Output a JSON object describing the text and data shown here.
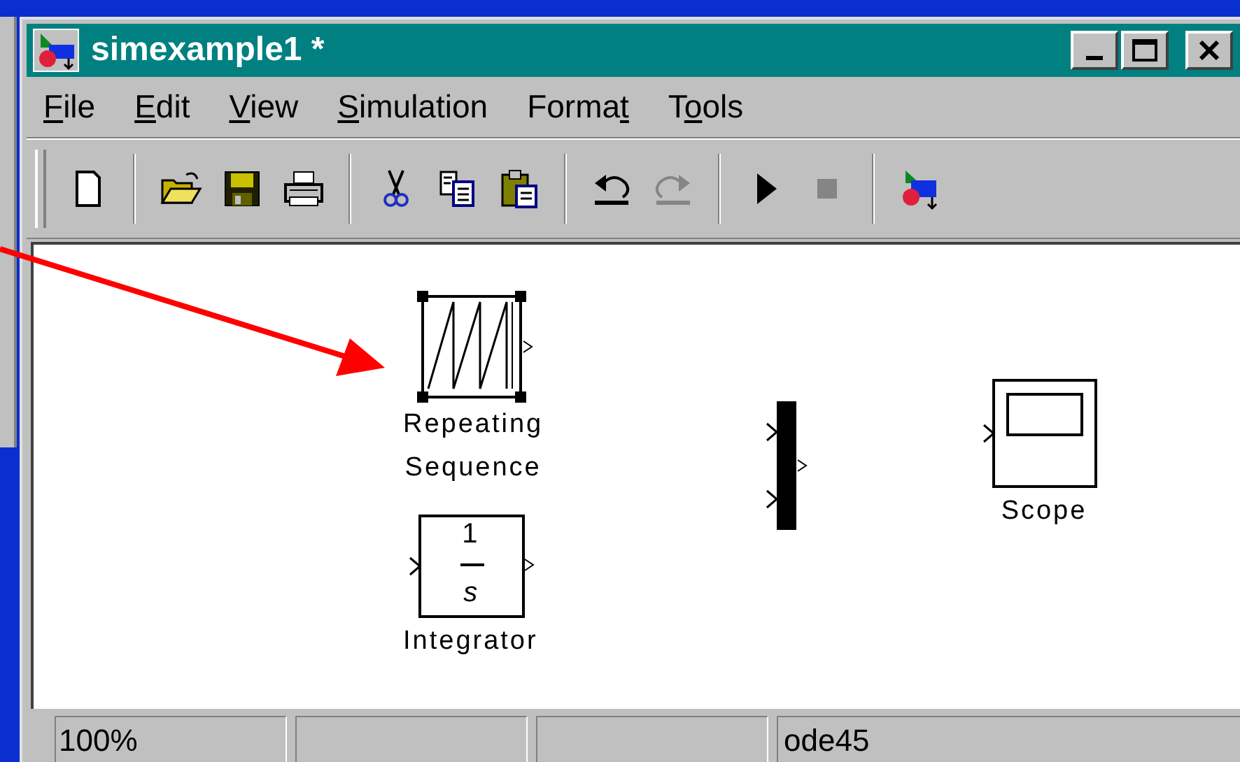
{
  "window": {
    "title": "simexample1 *"
  },
  "menu": [
    {
      "key": "F",
      "after": "ile"
    },
    {
      "key": "E",
      "after": "dit"
    },
    {
      "key": "V",
      "after": "iew"
    },
    {
      "key": "S",
      "after": "imulation"
    },
    {
      "before": "Forma",
      "key": "t"
    },
    {
      "before": "T",
      "key": "o",
      "after": "ols"
    }
  ],
  "toolbar_groups": [
    [
      {
        "kind": "new",
        "disabled": false
      }
    ],
    [
      {
        "kind": "open",
        "disabled": false
      },
      {
        "kind": "save",
        "disabled": false
      },
      {
        "kind": "print",
        "disabled": false
      }
    ],
    [
      {
        "kind": "cut",
        "disabled": false
      },
      {
        "kind": "copy",
        "disabled": false
      },
      {
        "kind": "paste",
        "disabled": false
      }
    ],
    [
      {
        "kind": "undo",
        "disabled": false
      },
      {
        "kind": "redo",
        "disabled": true
      }
    ],
    [
      {
        "kind": "start",
        "disabled": false
      },
      {
        "kind": "stop",
        "disabled": true
      }
    ],
    [
      {
        "kind": "library",
        "disabled": false
      }
    ]
  ],
  "blocks": [
    {
      "kind": "repeating_sequence",
      "label": [
        "Repeating",
        "Sequence"
      ],
      "selected": true
    },
    {
      "kind": "integrator",
      "numerator": "1",
      "denominator": "s",
      "label": [
        "Integrator"
      ],
      "selected": false
    },
    {
      "kind": "mux",
      "selected": false
    },
    {
      "kind": "scope",
      "label": [
        "Scope"
      ],
      "selected": false
    }
  ],
  "status_bar": {
    "zoom": "100%",
    "solver": "ode45"
  }
}
